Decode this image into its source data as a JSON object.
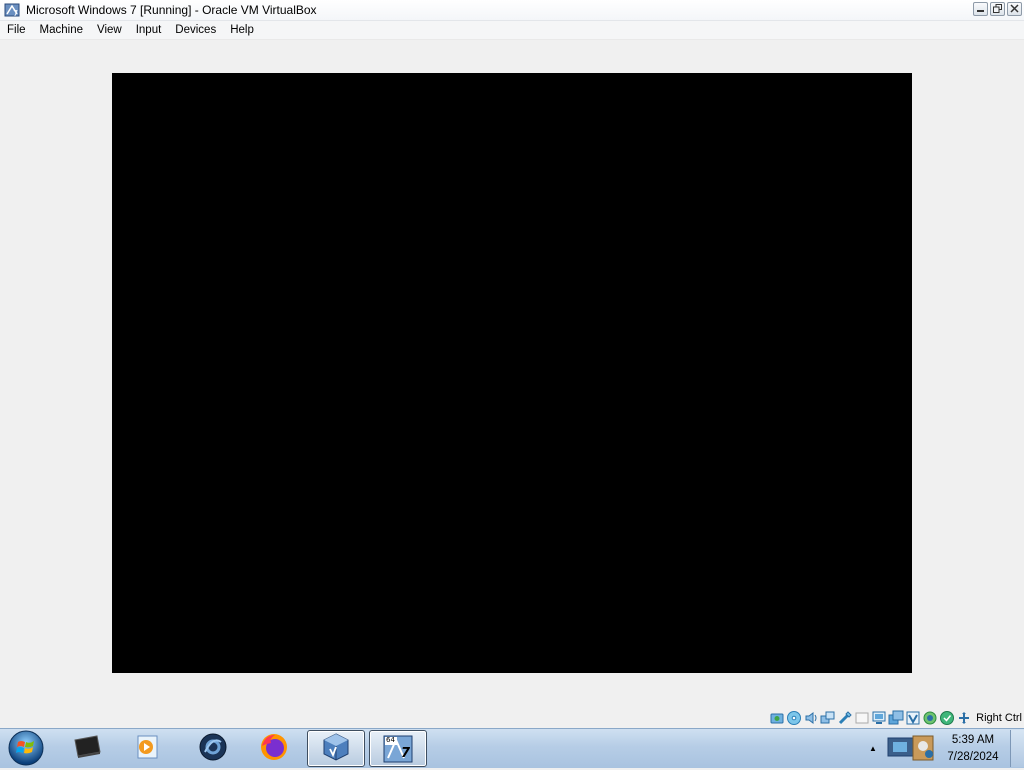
{
  "window": {
    "title": "Microsoft Windows 7 [Running] - Oracle VM VirtualBox",
    "icon": "virtualbox-icon",
    "controls": {
      "minimize_icon": "minimize-icon",
      "restore_icon": "restore-icon",
      "close_icon": "close-icon"
    }
  },
  "menubar": {
    "items": [
      "File",
      "Machine",
      "View",
      "Input",
      "Devices",
      "Help"
    ]
  },
  "vm_display": {
    "content": ""
  },
  "statusbar": {
    "icons": [
      "hard-disk-icon",
      "optical-drive-icon",
      "audio-icon",
      "network-icon",
      "usb-icon",
      "shared-folders-icon",
      "display-icon",
      "video-capture-icon",
      "virtualization-icon",
      "cpu-icon",
      "mouse-integration-icon",
      "keyboard-icon"
    ],
    "host_key": "Right Ctrl"
  },
  "taskbar": {
    "start_icon": "windows-start-orb-icon",
    "buttons": [
      {
        "icon": "terminal-icon",
        "active": false
      },
      {
        "icon": "media-player-icon",
        "active": false
      },
      {
        "icon": "settings-icon",
        "active": false
      },
      {
        "icon": "firefox-icon",
        "active": false
      },
      {
        "icon": "virtualbox-icon",
        "active": true
      },
      {
        "icon": "windows7-64-vm-icon",
        "active": true
      }
    ],
    "vm_badge": "64",
    "vm_number": "7",
    "tray_arrow_icon": "show-hidden-icons-arrow-icon",
    "tray_app_icon": "system-tray-app-icon",
    "clock": {
      "time": "5:39 AM",
      "date": "7/28/2024"
    }
  },
  "colors": {
    "window_bg": "#f0f0f0",
    "vm_screen": "#000000",
    "taskbar_top": "#cfe0f1",
    "taskbar_bottom": "#a9c3e0"
  }
}
